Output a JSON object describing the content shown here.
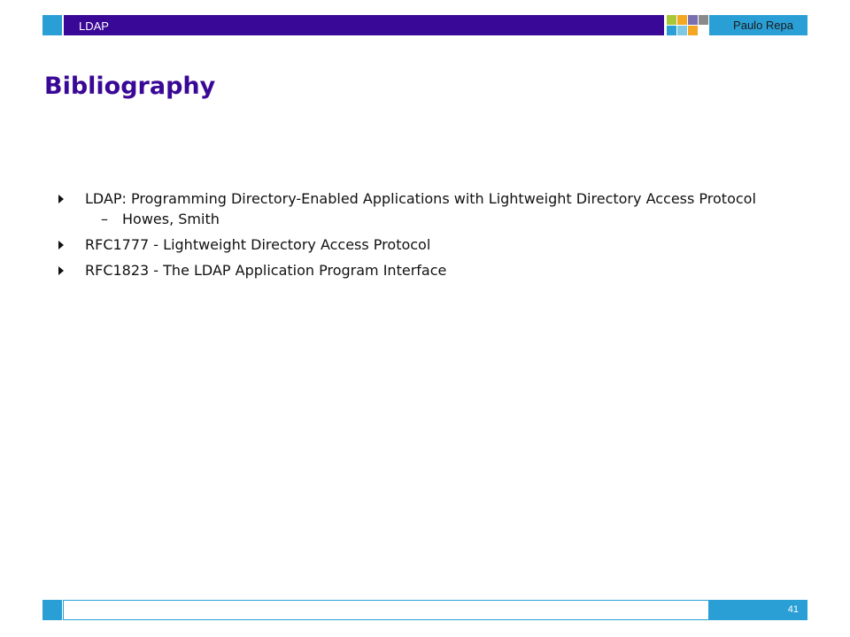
{
  "header": {
    "title": "LDAP",
    "author": "Paulo Repa",
    "colors": {
      "bar": "#3a0896",
      "accent": "#2a9fd6",
      "squares": [
        "#a8c83a",
        "#f5a623",
        "#7a6fb0",
        "#8a8a8a",
        "#2a9fd6",
        "#7ec8e3",
        "#f5a623",
        "#ffffff"
      ]
    }
  },
  "page": {
    "title": "Bibliography"
  },
  "bullets": [
    {
      "text": "LDAP: Programming Directory-Enabled Applications with Lightweight Directory Access Protocol",
      "sub": [
        {
          "dash": "–",
          "text": "Howes, Smith"
        }
      ]
    },
    {
      "text": "RFC1777 - Lightweight Directory Access Protocol"
    },
    {
      "text": "RFC1823 - The LDAP Application Program Interface"
    }
  ],
  "footer": {
    "page_number": "41"
  }
}
